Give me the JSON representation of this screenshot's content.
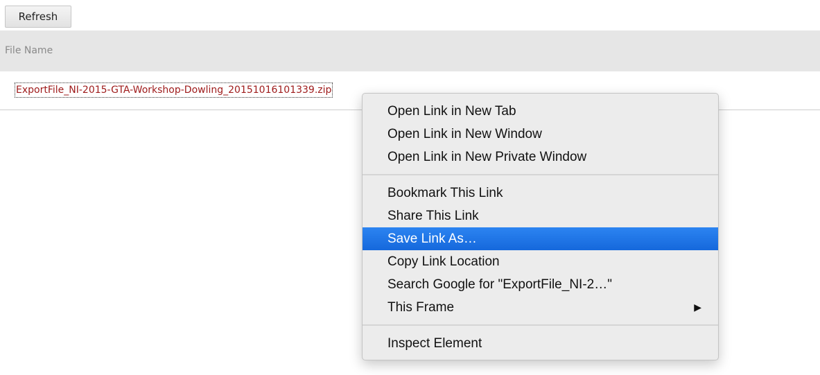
{
  "toolbar": {
    "refresh_label": "Refresh"
  },
  "table": {
    "header": "File Name",
    "file_link": "ExportFile_NI-2015-GTA-Workshop-Dowling_20151016101339.zip"
  },
  "context_menu": {
    "group1": [
      "Open Link in New Tab",
      "Open Link in New Window",
      "Open Link in New Private Window"
    ],
    "group2": [
      "Bookmark This Link",
      "Share This Link",
      "Save Link As…",
      "Copy Link Location",
      "Search Google for \"ExportFile_NI-2…\"",
      "This Frame"
    ],
    "group3": [
      "Inspect Element"
    ],
    "selected_item": "Save Link As…",
    "submenu_arrow": "▶"
  },
  "colors": {
    "selection": "#1a73e8",
    "link": "#9e1a1a",
    "header_bg": "#e6e6e6"
  }
}
